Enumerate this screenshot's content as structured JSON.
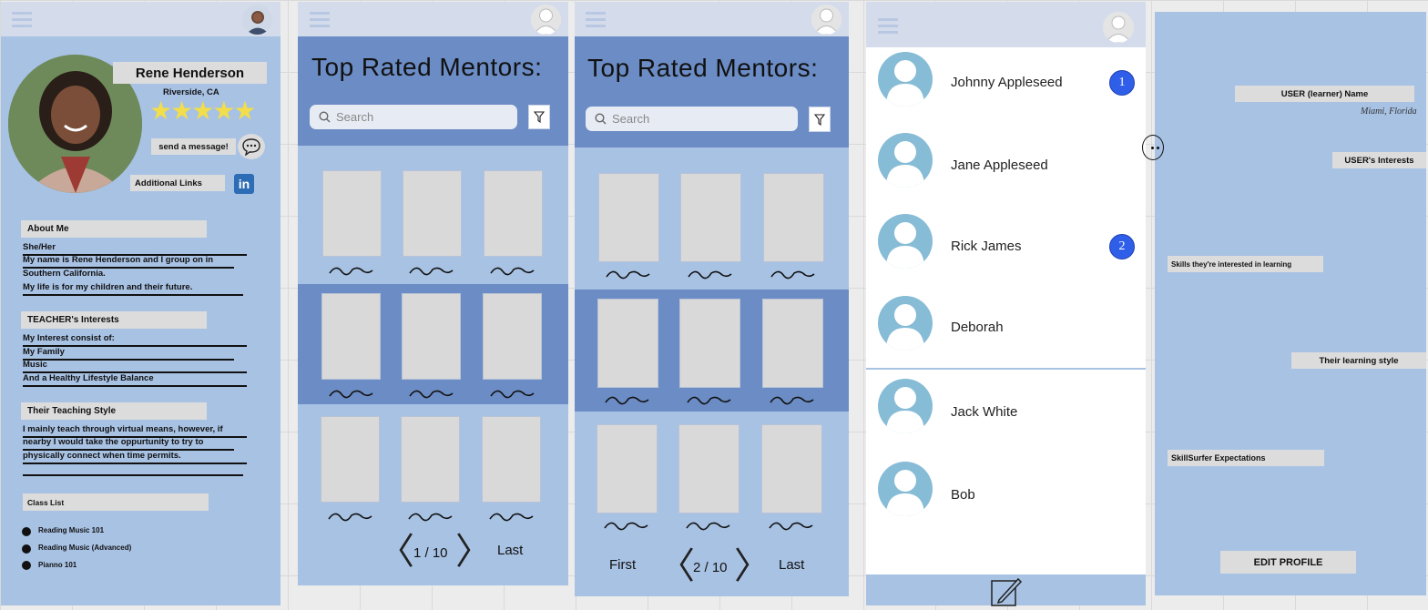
{
  "profile": {
    "name": "Rene Henderson",
    "location": "Riverside, CA",
    "stars": "★★★★★",
    "rating": 5,
    "message_button": "send a message!",
    "links_label": "Additional Links",
    "linkedin": "in",
    "about_heading": "About Me",
    "about_lines": [
      "She/Her",
      "My name is Rene Henderson and I group on in",
      "Southern California.",
      "My life is for my children and their future."
    ],
    "interests_heading": "TEACHER's Interests",
    "interests_lines": [
      "My Interest consist of:",
      "My Family",
      "Music",
      "And a Healthy Lifestyle Balance"
    ],
    "style_heading": "Their Teaching Style",
    "style_lines": [
      "I mainly teach through virtual means, however, if",
      "nearby I would take the oppurtunity to try to",
      "physically connect when time permits."
    ],
    "class_heading": "Class List",
    "classes": [
      "Reading Music 101",
      "Reading Music (Advanced)",
      "Pianno 101"
    ]
  },
  "mentors1": {
    "title": "Top Rated Mentors:",
    "search_placeholder": "Search",
    "page": "1 / 10",
    "last": "Last",
    "prev": "〈",
    "next": "〉"
  },
  "mentors2": {
    "title": "Top Rated Mentors:",
    "search_placeholder": "Search",
    "first": "First",
    "page": "2 / 10",
    "last": "Last",
    "prev": "〈",
    "next": "〉"
  },
  "contacts": {
    "items": [
      {
        "name": "Johnny Appleseed",
        "badge": "1"
      },
      {
        "name": "Jane Appleseed",
        "badge": ""
      },
      {
        "name": "Rick James",
        "badge": "2"
      },
      {
        "name": "Deborah",
        "badge": ""
      },
      {
        "name": "Jack White",
        "badge": ""
      },
      {
        "name": "Bob",
        "badge": ""
      }
    ]
  },
  "learner": {
    "name_label": "USER  (learner) Name",
    "location_script": "Miami, Florida",
    "interests_label": "USER's Interests",
    "skills_label": "Skills they're interested in learning",
    "style_label": "Their learning style",
    "expect_label": "SkillSurfer Expectations",
    "edit_button": "EDIT PROFILE"
  },
  "colors": {
    "panel": "#a8c2e4",
    "header": "#6b8cc4",
    "topbar": "#d4dcec",
    "badge": "#2f5fe8",
    "star": "#f2dd4a"
  }
}
